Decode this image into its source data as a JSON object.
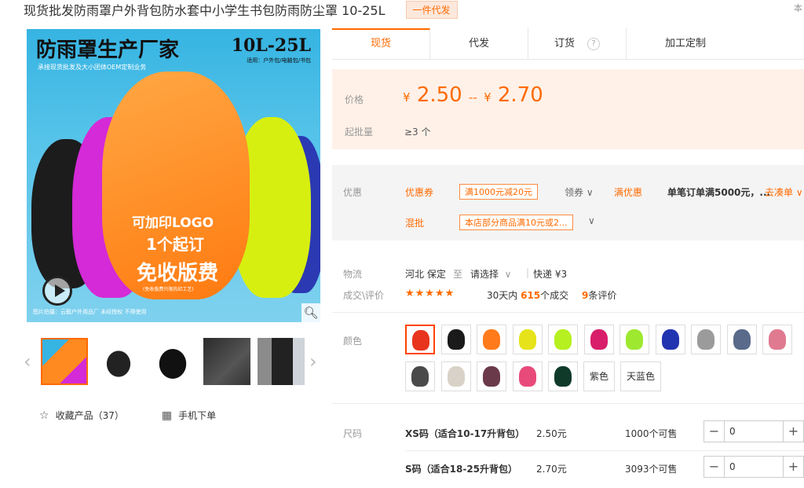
{
  "title": "现货批发防雨罩户外背包防水套中小学生书包防雨防尘罩 10-25L",
  "tag": "一件代发",
  "corner_text": "本",
  "main_image": {
    "headline": "防雨罩生产厂家",
    "subline": "承接现货批发及大小团体OEM定制业务",
    "size": "10L-25L",
    "size_sub": "适用：户外包/电脑包/书包",
    "line1": "可加印LOGO",
    "line2": "1个起订",
    "line3": "免收版费",
    "line4": "(免收版费只限热印工艺)",
    "footer": "图片拍摄：云懿户外用品厂 未经授权 不得使用"
  },
  "left_actions": {
    "favorite": "收藏产品（37）",
    "mobile": "手机下单"
  },
  "tabs": [
    "现货",
    "代发",
    "订货",
    "加工定制"
  ],
  "tab_help": "?",
  "price": {
    "label": "价格",
    "currency": "¥",
    "low": "2.50",
    "sep": "--",
    "high": "2.70",
    "moq_label": "起批量",
    "moq": "≥3 个"
  },
  "promo": {
    "label": "优惠",
    "coupon_label": "优惠券",
    "coupon_text": "满1000元减20元",
    "claim": "领券",
    "manyouhui_label": "满优惠",
    "manyouhui_text": "单笔订单满5000元，...",
    "go_link": "去凑单",
    "mixed_label": "混批",
    "mixed_text": "本店部分商品满10元或2..."
  },
  "logistics": {
    "label": "物流",
    "origin": "河北 保定",
    "to": "至",
    "dest": "请选择",
    "express": "快递 ¥3"
  },
  "review": {
    "label": "成交\\评价",
    "stars": "★★★★★",
    "days": "30天内",
    "count": "615",
    "deal": "个成交",
    "reviews": "9",
    "review_text": "条评价"
  },
  "colors": {
    "label": "颜色",
    "swatches": [
      "#e8341c",
      "#1a1a1a",
      "#ff7a1a",
      "#e6e31a",
      "#b6f020",
      "#d81e6a",
      "#9ee830",
      "#2235b0",
      "#9b9b9b",
      "#5a6a8a",
      "#e07a90",
      "#4a4a4a",
      "#d8d2c8",
      "#6a3a4a",
      "#e84a7a",
      "#0f3a2a"
    ],
    "text_options": [
      "紫色",
      "天蓝色"
    ]
  },
  "sizes": {
    "label": "尺码",
    "rows": [
      {
        "name": "XS码（适合10-17升背包）",
        "price": "2.50元",
        "stock": "1000个可售",
        "qty": "0"
      },
      {
        "name": "S码（适合18-25升背包）",
        "price": "2.70元",
        "stock": "3093个可售",
        "qty": "0"
      }
    ]
  }
}
